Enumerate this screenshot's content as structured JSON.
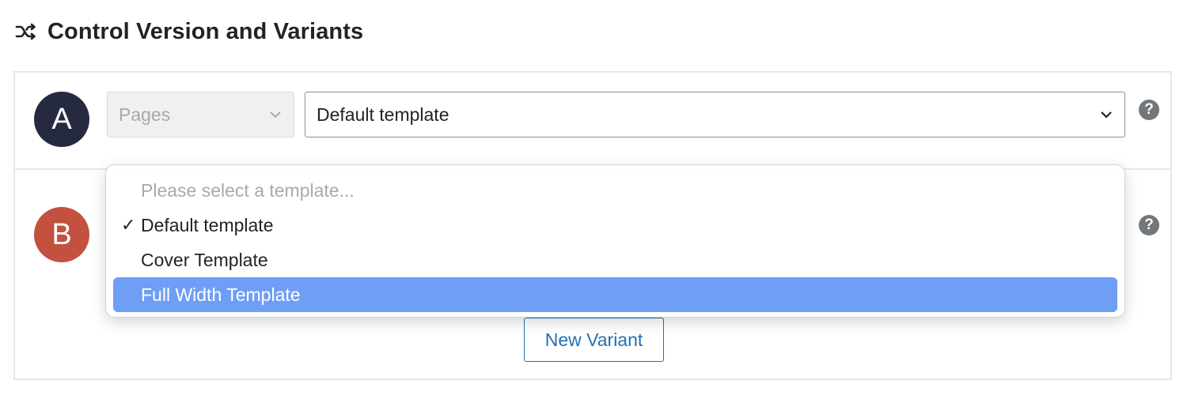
{
  "section": {
    "title": "Control Version and Variants",
    "icon": "shuffle-icon"
  },
  "rows": [
    {
      "badge": "A",
      "badge_color": "#262a41",
      "post_type": "Pages",
      "template": "Default template"
    },
    {
      "badge": "B",
      "badge_color": "#c2513f"
    }
  ],
  "help_glyph": "?",
  "new_variant_label": "New Variant",
  "dropdown": {
    "placeholder": "Please select a template...",
    "options": [
      {
        "label": "Default template",
        "state": "checked"
      },
      {
        "label": "Cover Template",
        "state": "normal"
      },
      {
        "label": "Full Width Template",
        "state": "highlighted"
      }
    ],
    "check_glyph": "✓",
    "highlight_color": "#6f9ef5"
  },
  "colors": {
    "link_blue": "#2271b1",
    "border": "#e4e7ed"
  }
}
